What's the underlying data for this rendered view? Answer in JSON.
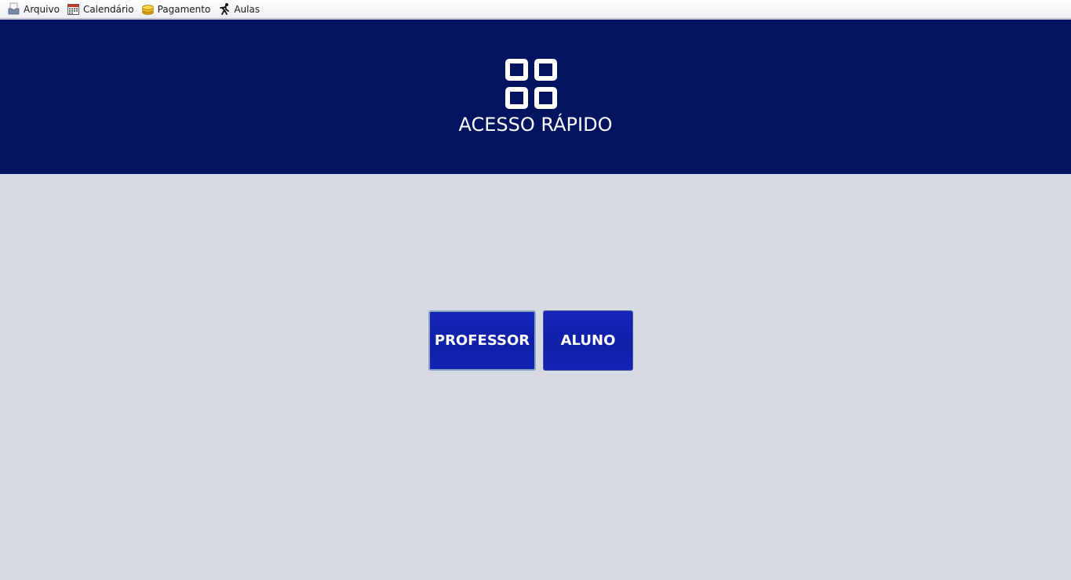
{
  "menubar": {
    "items": [
      {
        "label": "Arquivo",
        "icon": "inbox-tray-icon"
      },
      {
        "label": "Calendário",
        "icon": "calendar-icon"
      },
      {
        "label": "Pagamento",
        "icon": "coins-icon"
      },
      {
        "label": "Aulas",
        "icon": "running-person-icon"
      }
    ]
  },
  "banner": {
    "icon": "grid-apps-icon",
    "title": "ACESSO RÁPIDO",
    "background": "#021460"
  },
  "actions": {
    "professor_label": "PROFESSOR",
    "aluno_label": "ALUNO",
    "button_color": "#1424b3"
  }
}
